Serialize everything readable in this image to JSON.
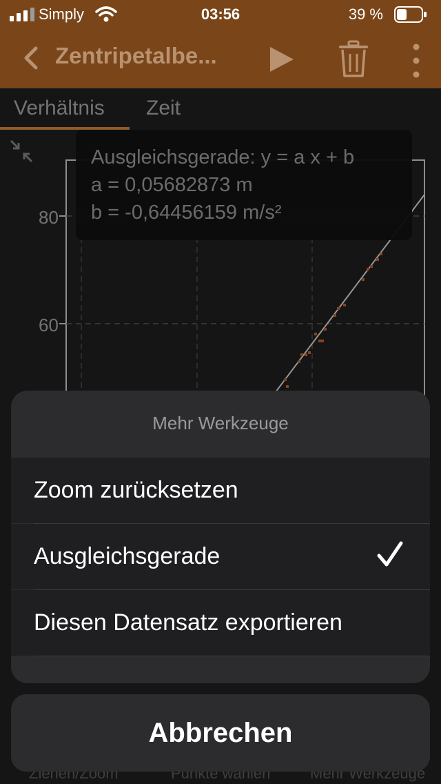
{
  "status": {
    "carrier": "Simply",
    "time": "03:56",
    "battery": "39 %"
  },
  "nav": {
    "title": "Zentripetalbe..."
  },
  "tabs": [
    {
      "label": "Verhältnis",
      "selected": true
    },
    {
      "label": "Zeit",
      "selected": false
    }
  ],
  "fit": {
    "line1": "Ausgleichsgerade: y = a x + b",
    "line2": "a = 0,05682873 m",
    "line3": "b = -0,64456159 m/s²"
  },
  "chart": {
    "y_ticks": [
      "80",
      "60"
    ]
  },
  "sheet": {
    "title": "Mehr Werkzeuge",
    "options": [
      {
        "label": "Zoom zurücksetzen",
        "checked": false
      },
      {
        "label": "Ausgleichsgerade",
        "checked": true
      },
      {
        "label": "Diesen Datensatz exportieren",
        "checked": false
      }
    ],
    "cancel": "Abbrechen"
  },
  "bottom_toolbar": {
    "left": "Ziehen/Zoom",
    "center": "Punkte wählen",
    "right": "Mehr Werkzeuge"
  },
  "colors": {
    "accent": "#c07a3d",
    "navbar": "#7a4619",
    "data_points": "#b85a2a"
  }
}
